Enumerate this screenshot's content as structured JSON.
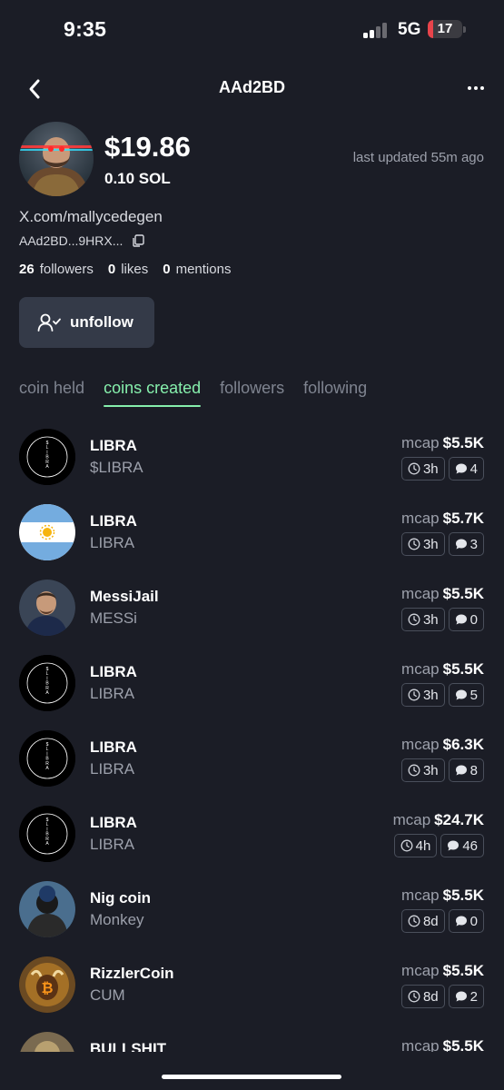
{
  "status_bar": {
    "time": "9:35",
    "network": "5G",
    "battery": "17",
    "battery_level": 0.17
  },
  "header": {
    "title": "AAd2BD"
  },
  "profile": {
    "balance_usd": "$19.86",
    "balance_sol": "0.10 SOL",
    "last_updated": "last updated 55m ago",
    "x_link": "X.com/mallycedegen",
    "address": "AAd2BD...9HRX...",
    "stats": {
      "followers_count": "26",
      "followers_label": "followers",
      "likes_count": "0",
      "likes_label": "likes",
      "mentions_count": "0",
      "mentions_label": "mentions"
    },
    "unfollow_label": "unfollow"
  },
  "tabs": [
    {
      "label": "coin held",
      "active": false
    },
    {
      "label": "coins created",
      "active": true
    },
    {
      "label": "followers",
      "active": false
    },
    {
      "label": "following",
      "active": false
    }
  ],
  "coins": [
    {
      "name": "LIBRA",
      "ticker": "$LIBRA",
      "mcap_label": "mcap",
      "mcap": "$5.5K",
      "age": "3h",
      "replies": "4",
      "icon": "libra-logo"
    },
    {
      "name": "LIBRA",
      "ticker": "LIBRA",
      "mcap_label": "mcap",
      "mcap": "$5.7K",
      "age": "3h",
      "replies": "3",
      "icon": "argentina-flag"
    },
    {
      "name": "MessiJail",
      "ticker": "MESSi",
      "mcap_label": "mcap",
      "mcap": "$5.5K",
      "age": "3h",
      "replies": "0",
      "icon": "messi-photo"
    },
    {
      "name": "LIBRA",
      "ticker": "LIBRA",
      "mcap_label": "mcap",
      "mcap": "$5.5K",
      "age": "3h",
      "replies": "5",
      "icon": "libra-logo"
    },
    {
      "name": "LIBRA",
      "ticker": "LIBRA",
      "mcap_label": "mcap",
      "mcap": "$6.3K",
      "age": "3h",
      "replies": "8",
      "icon": "libra-logo"
    },
    {
      "name": "LIBRA",
      "ticker": "LIBRA",
      "mcap_label": "mcap",
      "mcap": "$24.7K",
      "age": "4h",
      "replies": "46",
      "icon": "libra-logo"
    },
    {
      "name": "Nig coin",
      "ticker": "Monkey",
      "mcap_label": "mcap",
      "mcap": "$5.5K",
      "age": "8d",
      "replies": "0",
      "icon": "monkey-photo"
    },
    {
      "name": "RizzlerCoin",
      "ticker": "CUM",
      "mcap_label": "mcap",
      "mcap": "$5.5K",
      "age": "8d",
      "replies": "2",
      "icon": "bull-photo"
    },
    {
      "name": "BULLSHIT",
      "ticker": "",
      "mcap_label": "mcap",
      "mcap": "$5.5K",
      "age": "",
      "replies": "",
      "icon": "bull-art"
    }
  ],
  "libra_logo_text": "$LIBRA",
  "colors": {
    "background": "#1b1d26",
    "accent": "#86efac",
    "button_bg": "#343a48",
    "muted_text": "#9ca0ab"
  }
}
